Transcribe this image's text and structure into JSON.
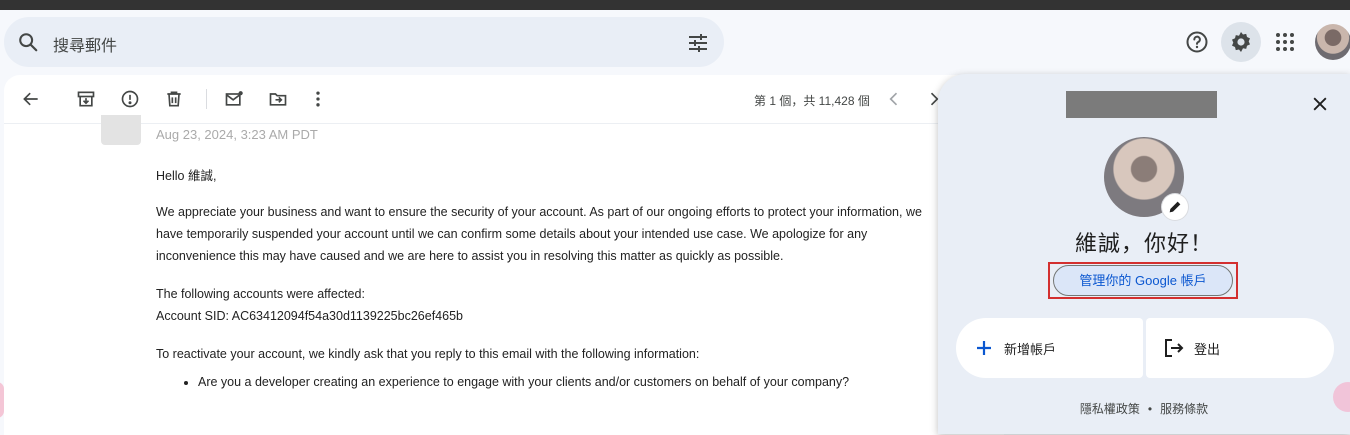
{
  "search": {
    "placeholder": "搜尋郵件"
  },
  "toolbar": {
    "page_count": "第 1 個，共 11,428 個"
  },
  "email": {
    "date": "Aug 23, 2024, 3:23 AM PDT",
    "greeting": "Hello 維誠,",
    "paragraph1": "We appreciate your business and want to ensure the security of your account. As part of our ongoing efforts to protect your information, we have temporarily suspended your account until we can confirm some details about your intended use case. We apologize for any inconvenience this may have caused and we are here to assist you in resolving this matter as quickly as possible.",
    "affected_line1": "The following accounts were affected:",
    "affected_line2": "Account SID: AC63412094f54a30d1139225bc26ef465b",
    "reactivate": "To reactivate your account, we kindly ask that you reply to this email with the following information:",
    "bullet1": "Are you a developer creating an experience to engage with your clients and/or customers on behalf of your company?"
  },
  "account_popup": {
    "greeting": "維誠，你好！",
    "manage_button": "管理你的 Google 帳戶",
    "add_account": "新增帳戶",
    "sign_out": "登出",
    "privacy": "隱私權政策",
    "separator": "•",
    "terms": "服務條款"
  },
  "icons": {
    "search": "search-icon",
    "filter": "tune-icon",
    "help": "help-icon",
    "settings": "gear-icon",
    "apps": "apps-grid-icon",
    "back": "arrow-back-icon",
    "archive": "archive-icon",
    "spam": "report-spam-icon",
    "delete": "trash-icon",
    "unread": "mark-unread-icon",
    "move": "move-to-icon",
    "more": "more-vert-icon",
    "prev": "chevron-left-icon",
    "next": "chevron-right-icon",
    "close": "close-icon",
    "edit": "pencil-icon",
    "add": "plus-icon",
    "logout": "logout-icon"
  },
  "colors": {
    "accent": "#0b57d0",
    "highlight": "#d32f2f",
    "panel": "#e9eef6"
  }
}
